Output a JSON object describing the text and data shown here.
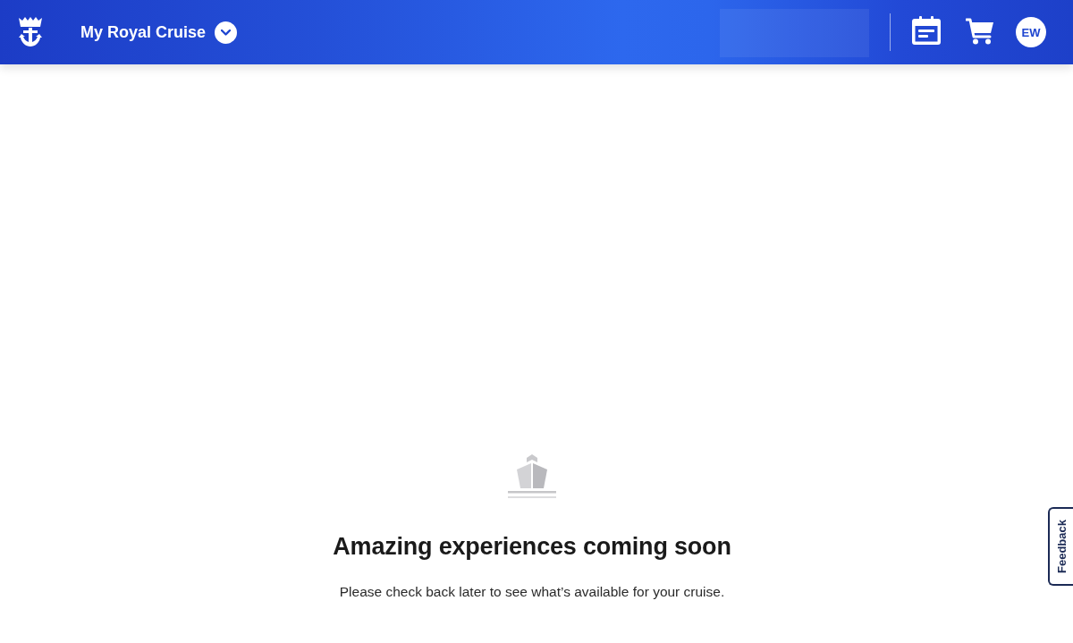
{
  "header": {
    "title": "My Royal Cruise",
    "avatar_initials": "EW"
  },
  "empty_state": {
    "heading": "Amazing experiences coming soon",
    "message": "Please check back later to see what’s available for your cruise."
  },
  "feedback_tab": {
    "label": "Feedback"
  }
}
